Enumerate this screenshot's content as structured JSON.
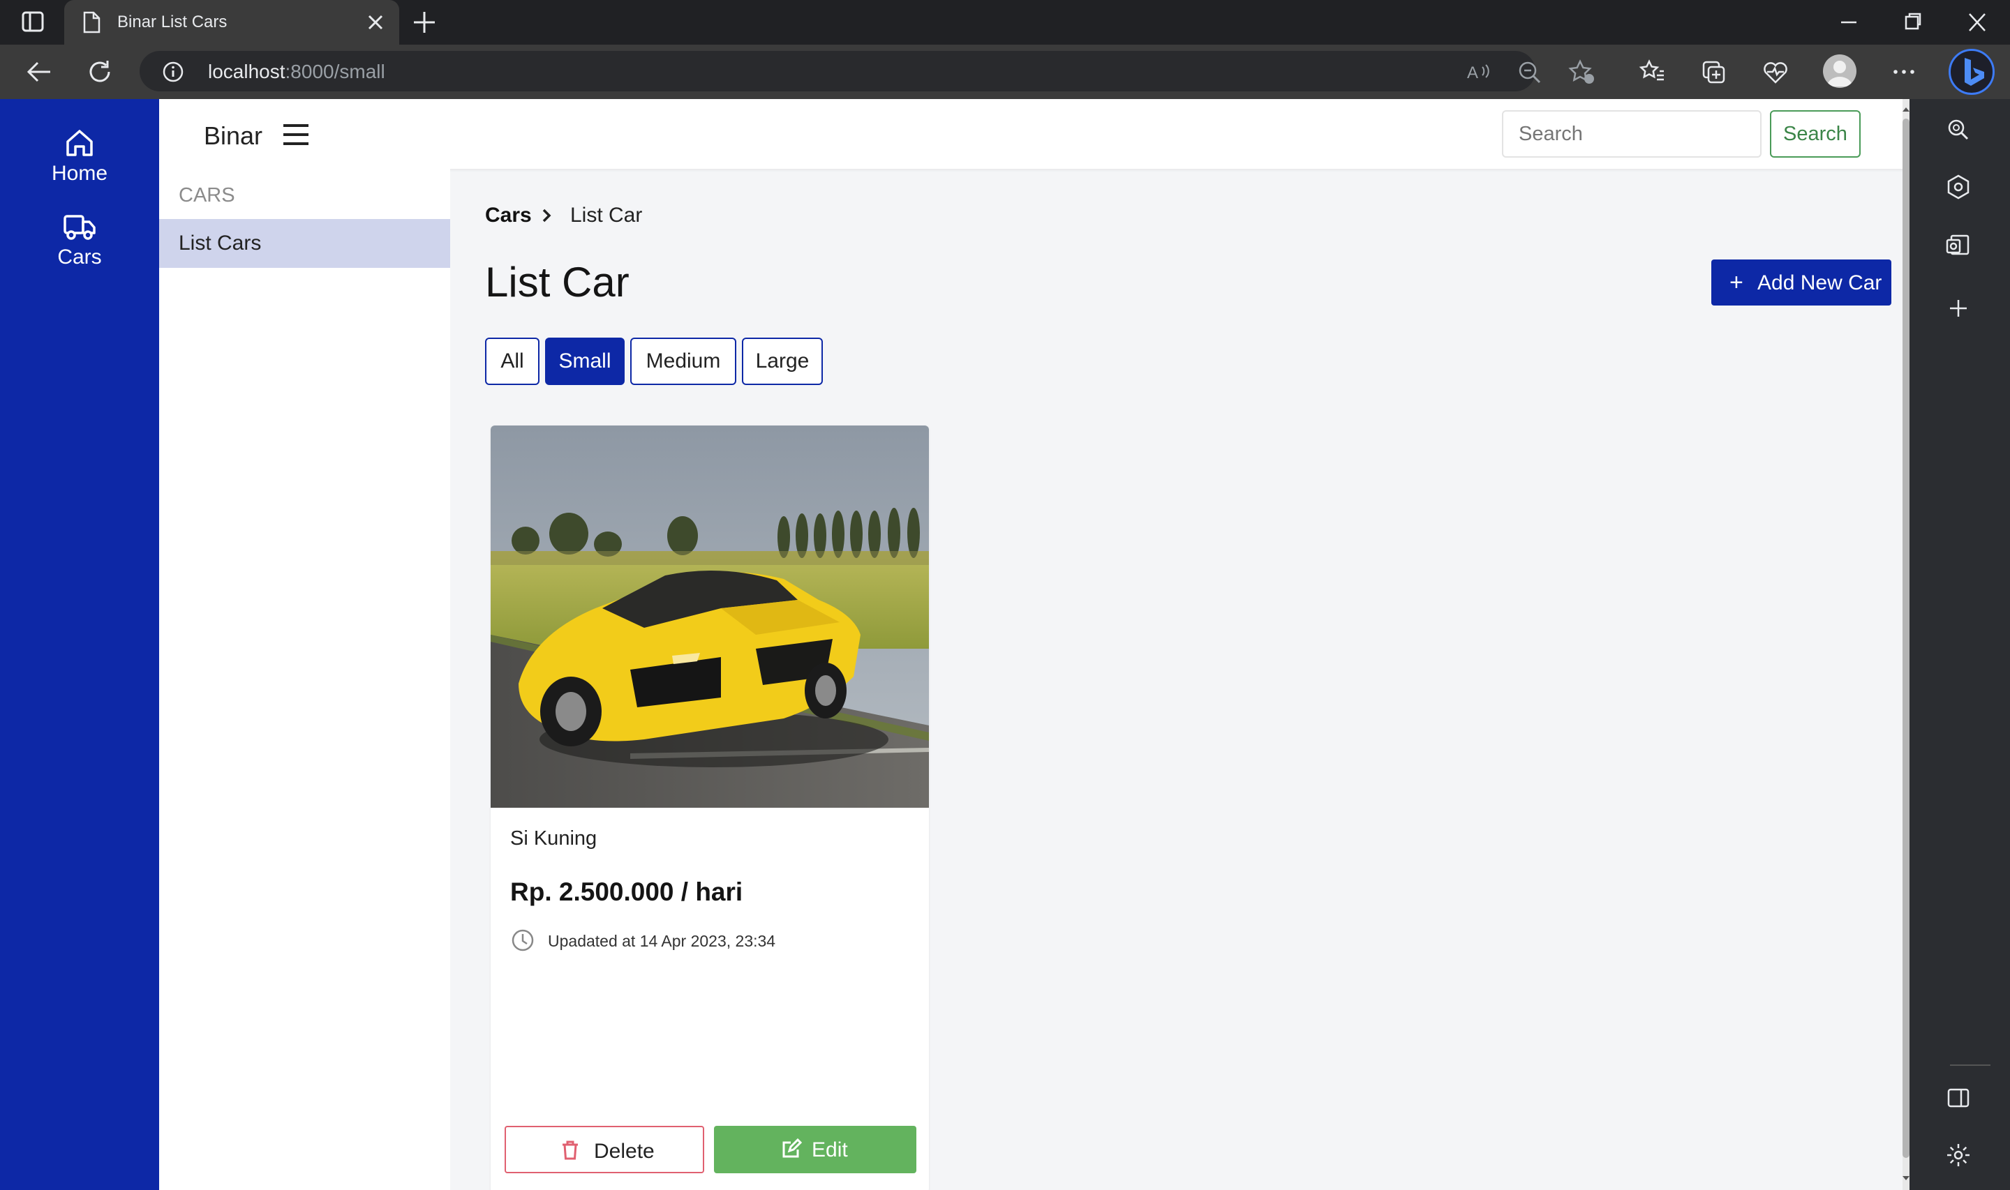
{
  "browser": {
    "tab_title": "Binar List Cars",
    "url_host": "localhost",
    "url_path": ":8000/small"
  },
  "app": {
    "brand": "Binar",
    "search_placeholder": "Search",
    "search_button": "Search"
  },
  "left_nav": [
    {
      "label": "Home",
      "icon": "home-icon"
    },
    {
      "label": "Cars",
      "icon": "truck-icon"
    }
  ],
  "sub_nav": {
    "heading": "CARS",
    "items": [
      {
        "label": "List Cars",
        "active": true
      }
    ]
  },
  "breadcrumb": {
    "root": "Cars",
    "current": "List Car"
  },
  "page_title": "List Car",
  "add_button": {
    "plus": "+",
    "label": "Add New Car"
  },
  "filters": [
    {
      "label": "All",
      "active": false
    },
    {
      "label": "Small",
      "active": true
    },
    {
      "label": "Medium",
      "active": false
    },
    {
      "label": "Large",
      "active": false
    }
  ],
  "cars": [
    {
      "name": "Si Kuning",
      "price": "Rp. 2.500.000 / hari",
      "updated": "Upadated at 14 Apr 2023, 23:34",
      "delete_label": "Delete",
      "edit_label": "Edit"
    }
  ],
  "colors": {
    "primary": "#0d28a6",
    "success": "#63b35e",
    "danger": "#e06070",
    "active_subnav": "#cfd4ec"
  }
}
